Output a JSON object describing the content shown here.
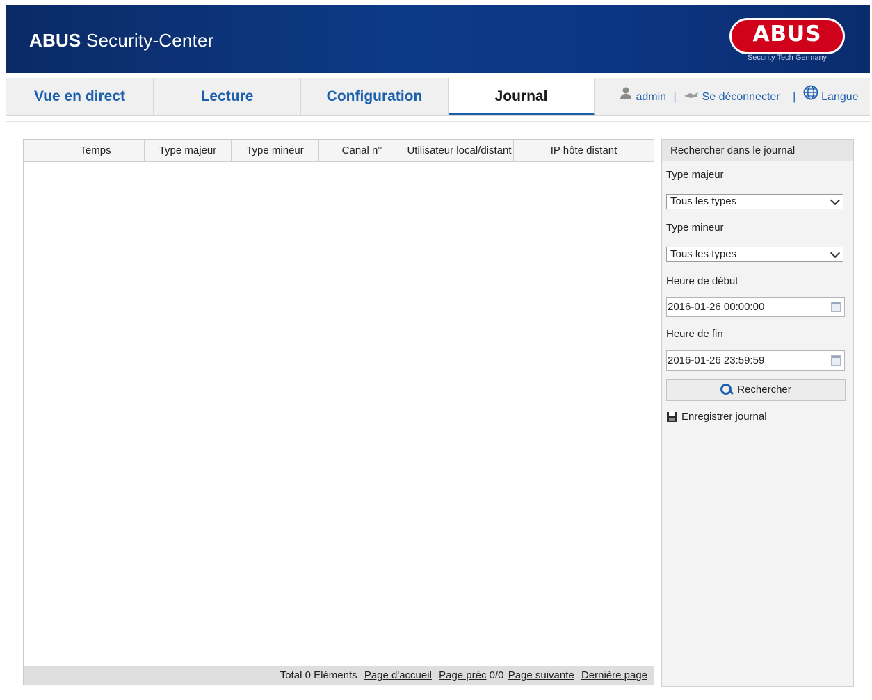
{
  "header": {
    "app_name_bold": "ABUS",
    "app_name_rest": "Security-Center",
    "logo_text": "ABUS",
    "logo_tagline": "Security Tech Germany",
    "colors": {
      "banner": "#0d3a86",
      "logo_red": "#d0021b"
    }
  },
  "nav": {
    "tabs": [
      {
        "label": "Vue en direct",
        "active": false
      },
      {
        "label": "Lecture",
        "active": false
      },
      {
        "label": "Configuration",
        "active": false
      },
      {
        "label": "Journal",
        "active": true
      }
    ],
    "user": "admin",
    "separator": "|",
    "logout": "Se déconnecter",
    "language": "Langue",
    "icons": [
      "user-icon",
      "logout-icon",
      "globe-icon"
    ],
    "accent_color": "#1c5fae"
  },
  "log_table": {
    "columns": [
      "",
      "Temps",
      "Type majeur",
      "Type mineur",
      "Canal n°",
      "Utilisateur local/distant",
      "IP hôte distant"
    ],
    "rows": [],
    "footer": {
      "total": "Total 0 Eléments",
      "first": "Page d'accueil",
      "prev": "Page préc",
      "page": "0/0",
      "next": "Page suivante",
      "last": "Dernière page"
    }
  },
  "search_panel": {
    "title": "Rechercher dans le journal",
    "major_type_label": "Type majeur",
    "major_type_value": "Tous les types",
    "minor_type_label": "Type mineur",
    "minor_type_value": "Tous les types",
    "start_label": "Heure de début",
    "start_value": "2016-01-26 00:00:00",
    "end_label": "Heure de fin",
    "end_value": "2016-01-26 23:59:59",
    "search_button": "Rechercher",
    "save_link": "Enregistrer journal"
  }
}
